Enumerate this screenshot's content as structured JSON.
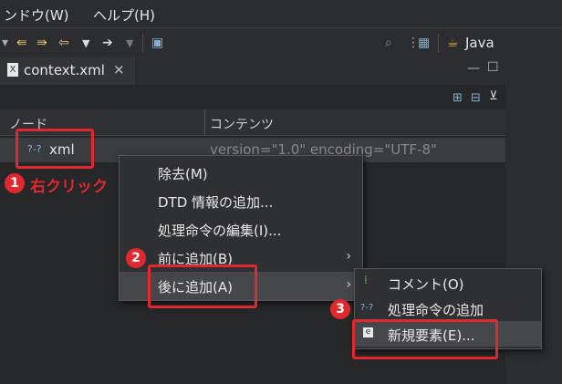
{
  "menubar": {
    "window_label": "ンドウ(W)",
    "help_label": "ヘルプ(H)"
  },
  "toolbar": {
    "perspective_label": "Java"
  },
  "editor": {
    "tab_title": "context.xml",
    "tab_close": "×"
  },
  "tree": {
    "col_node": "ノード",
    "col_content": "コンテンツ",
    "row_node": "xml",
    "row_value": "version=\"1.0\" encoding=\"UTF-8\""
  },
  "context_menu": {
    "items": [
      {
        "label": "除去(M)"
      },
      {
        "label": "DTD 情報の追加..."
      },
      {
        "label": "処理命令の編集(I)..."
      },
      {
        "label": "前に追加(B)"
      },
      {
        "label": "後に追加(A)"
      }
    ],
    "arrow": "›"
  },
  "submenu": {
    "items": [
      {
        "label": "コメント(O)"
      },
      {
        "label": "処理命令の追加"
      },
      {
        "label": "新規要素(E)..."
      }
    ]
  },
  "annotations": {
    "step1": "1",
    "step1_text": "右クリック",
    "step2": "2",
    "step3": "3"
  },
  "colors": {
    "accent_red": "#e0282e"
  }
}
